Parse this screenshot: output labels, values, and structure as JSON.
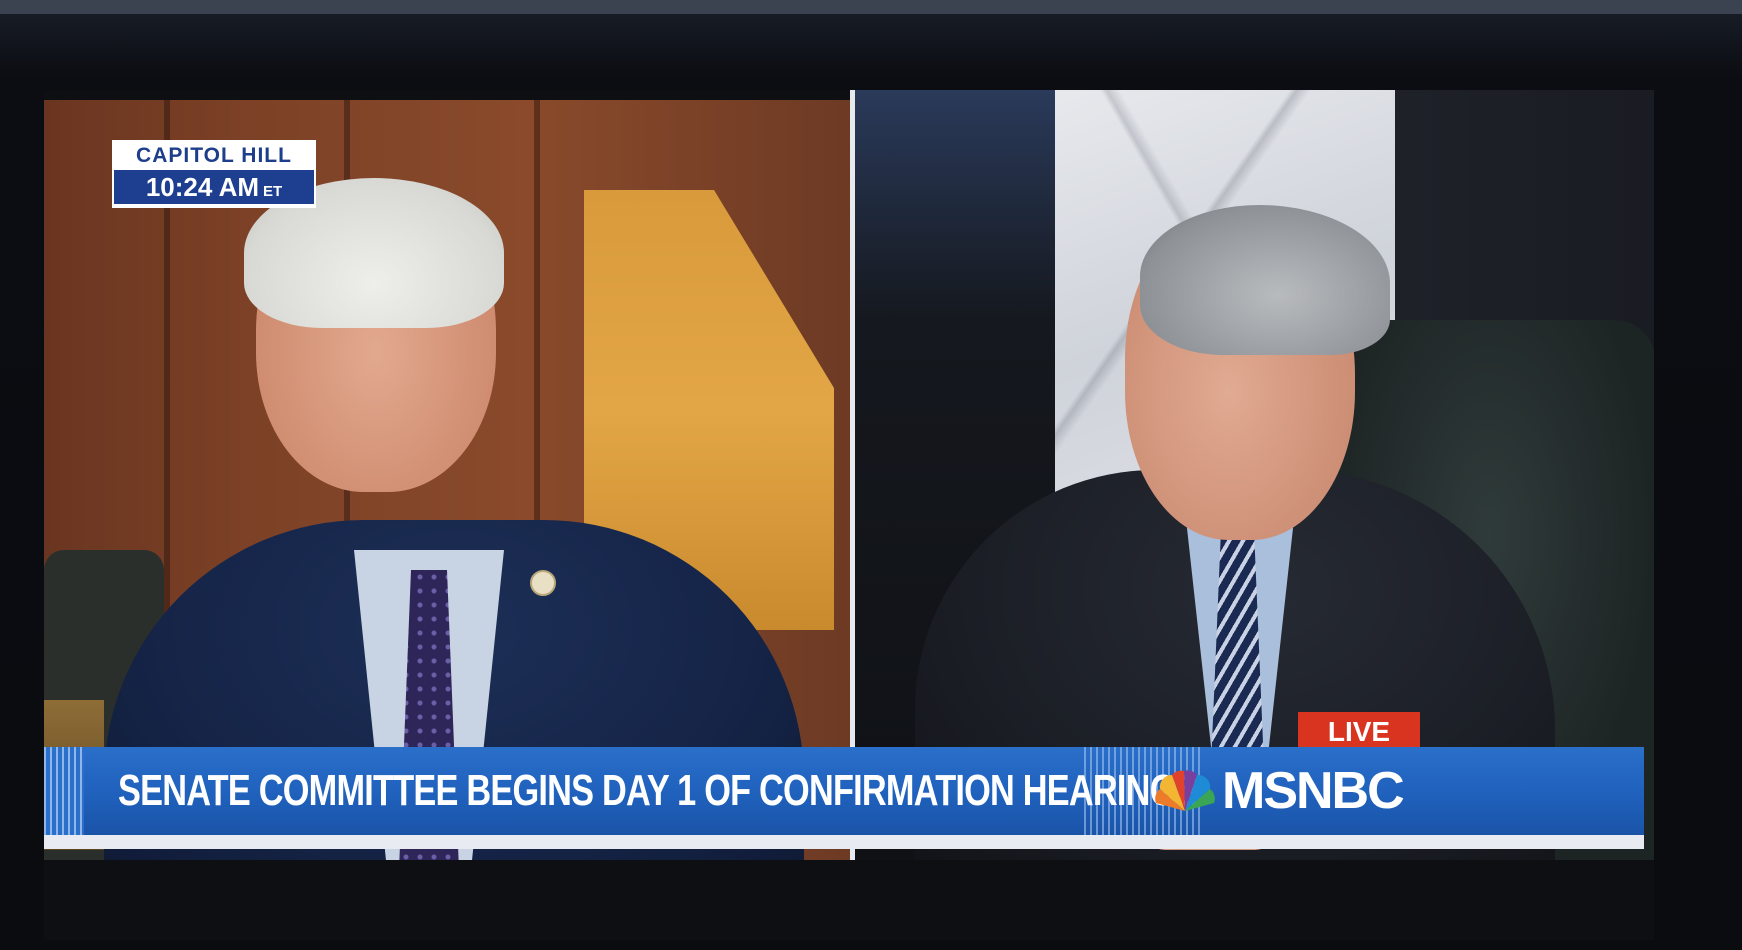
{
  "broadcast": {
    "location": {
      "place": "CAPITOL HILL",
      "time": "10:24 AM",
      "timezone": "ET"
    },
    "live_label": "LIVE",
    "lower_third": {
      "headline": "SENATE COMMITTEE BEGINS DAY 1 OF CONFIRMATION HEARINGS"
    },
    "network": {
      "name": "MSNBC",
      "icon": "peacock-icon"
    }
  },
  "colors": {
    "lower_third_blue": "#2062be",
    "live_red": "#d9341f",
    "location_blue": "#1e3f8f"
  }
}
